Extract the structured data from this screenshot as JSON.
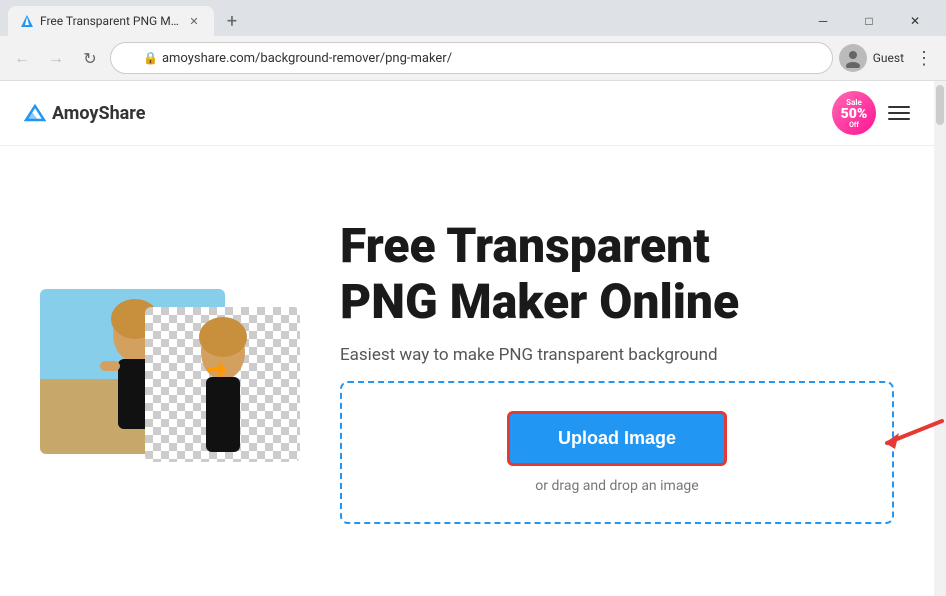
{
  "browser": {
    "tab_title": "Free Transparent PNG Maker -",
    "new_tab_label": "+",
    "url": "amoyshare.com/background-remover/png-maker/",
    "guest_label": "Guest",
    "window_minimize": "─",
    "window_maximize": "□",
    "window_close": "✕"
  },
  "header": {
    "logo_text": "AmoyShare",
    "sale_label": "Sale",
    "sale_percent": "50%",
    "sale_off": "Off"
  },
  "main": {
    "title_line1": "Free Transparent",
    "title_line2": "PNG Maker Online",
    "subtitle": "Easiest way to make PNG transparent background",
    "upload_button": "Upload Image",
    "drag_drop_text": "or drag and drop an image"
  }
}
